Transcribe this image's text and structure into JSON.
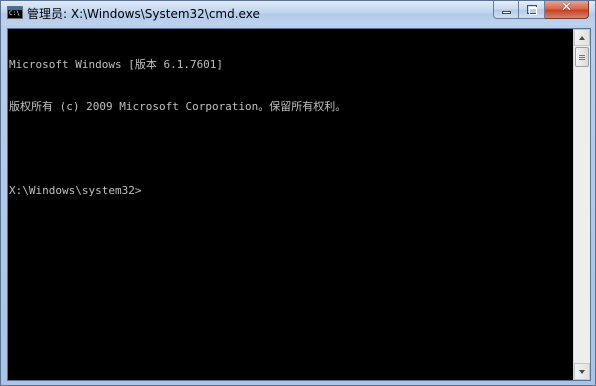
{
  "window": {
    "title": "管理员: X:\\Windows\\System32\\cmd.exe",
    "icon": "cmd-icon",
    "icon_text": "C:\\",
    "controls": {
      "minimize": "minimize-icon",
      "maximize": "maximize-icon",
      "close": "close-icon",
      "close_glyph": "✕"
    }
  },
  "console": {
    "background": "#000000",
    "foreground": "#c0c0c0",
    "lines": [
      "Microsoft Windows [版本 6.1.7601]",
      "版权所有 (c) 2009 Microsoft Corporation。保留所有权利。",
      "",
      "X:\\Windows\\system32>"
    ]
  },
  "scrollbar": {
    "up": "scroll-up-arrow-icon",
    "down": "scroll-down-arrow-icon"
  }
}
